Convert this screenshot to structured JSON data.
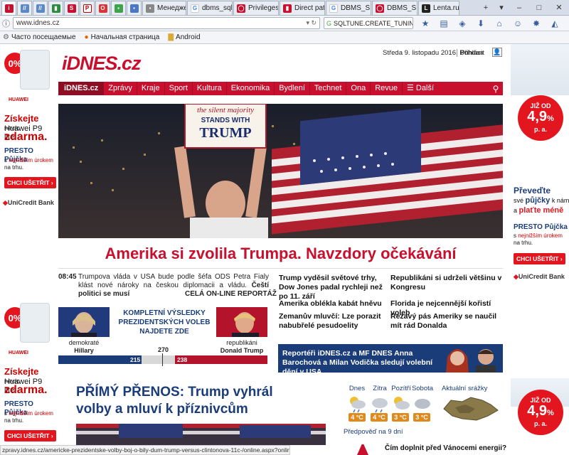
{
  "browser": {
    "tabs": [
      {
        "label": "",
        "icon": "red-i"
      },
      {
        "label": "",
        "icon": "bookmark"
      },
      {
        "label": "",
        "icon": "bookmark"
      },
      {
        "label": "",
        "icon": "flag"
      },
      {
        "label": "",
        "icon": "S"
      },
      {
        "label": "",
        "icon": "P"
      },
      {
        "label": "",
        "icon": "O"
      },
      {
        "label": "",
        "icon": "blue"
      },
      {
        "label": "",
        "icon": "doc"
      },
      {
        "label": "Менедже...",
        "icon": "doc"
      },
      {
        "label": "dbms_sql...",
        "icon": "G"
      },
      {
        "label": "Privileges...",
        "icon": "oracle"
      },
      {
        "label": "Direct pat...",
        "icon": "bookmark"
      },
      {
        "label": "DBMS_S...",
        "icon": "G"
      },
      {
        "label": "DBMS_S...",
        "icon": "oracle"
      },
      {
        "label": "Lenta.ru",
        "icon": "L"
      }
    ],
    "url": "www.idnes.cz",
    "search_text": "SQLTUNE.CREATE_TUNING_TASK",
    "bookmarks": [
      "Часто посещаемые",
      "Начальная страница",
      "Android"
    ],
    "status_url": "zpravy.idnes.cz/americke-prezidentske-volby-boj-o-bily-dum-trump-versus-clintonova-11c-/online.aspx?online=1006336"
  },
  "ad_left": {
    "promo_label": "0%",
    "brand": "HUAWEI",
    "line1": "Získejte",
    "line1b": "navíc",
    "line2": "Huawei P9 lite",
    "line3": "zdarma.",
    "line4": "PRESTO Půjčka",
    "line5a": "s",
    "line5b": "nejnižším úrokem",
    "line6": "na trhu.",
    "button": "CHCI UŠETŘIT ›",
    "bank": "UniCredit Bank"
  },
  "ad_right": {
    "badge_top": "JIŽ OD",
    "badge_value": "4,9",
    "badge_unit": "%",
    "badge_sub": "p. a.",
    "line1": "Převeďte",
    "line2a": "své",
    "line2b": "půjčky",
    "line2c": "k nám",
    "line3a": "a",
    "line3b": "plaťte méně",
    "line4": "PRESTO Půjčka",
    "line5a": "s",
    "line5b": "nejnižším úrokem",
    "line6": "na trhu.",
    "button": "CHCI UŠETŘIT ›",
    "bank": "UniCredit Bank"
  },
  "header": {
    "logo": "iDNES.cz",
    "date": "Středa 9. listopadu 2016. Bohdan",
    "login": "Přihlásit"
  },
  "nav": {
    "brand": "iDNES.cz",
    "items": [
      "Zprávy",
      "Kraje",
      "Sport",
      "Kultura",
      "Ekonomika",
      "Bydlení",
      "Technet",
      "Ona",
      "Revue",
      "☰ Další"
    ]
  },
  "hero": {
    "sign_line1": "the silent majority",
    "sign_line2": "STANDS WITH",
    "sign_line3": "TRUMP",
    "headline": "Amerika si zvolila Trumpa. Navzdory očekávání"
  },
  "live": {
    "time": "08:45",
    "text": "Trumpova vláda v USA bude podle šéfa ODS Petra Fialy klást nové nároky na českou diplomacii a vládu.",
    "text_bold": "Čeští politici se musí",
    "more": "CELÁ ON-LINE REPORTÁŽ"
  },
  "results": {
    "title": "KOMPLETNÍ VÝSLEDKY PREZIDENTSKÝCH VOLEB NAJDETE ZDE",
    "left_party": "demokraté",
    "left_name": "Hillary Clintonová",
    "right_party": "republikáni",
    "right_name": "Donald Trump",
    "threshold": "270",
    "clinton_votes": 215,
    "trump_votes": 238,
    "clinton_label": "215",
    "trump_label": "238"
  },
  "stories_mid": [
    "Trump vyděsil světové trhy, Dow Jones padal rychleji než po 11. září",
    "Amerika oblékla kabát hněvu",
    "Zemanův mluvčí: Lze porazit nabubřelé pesudoelity"
  ],
  "stories_right": [
    "Republikáni si udrželi většinu v Kongresu",
    "Florida je nejcennější kořistí voleb",
    "Rezavý pás Ameriky se naučil mít rád Donalda"
  ],
  "promo": "Reportéři iDNES.cz a MF DNES Anna Barochová a Milan Vodička sledují volební dění v USA",
  "live2": "PŘÍMÝ PŘENOS: Trump vyhrál volby a mluví k příznivcům",
  "weather": {
    "days": [
      "Dnes",
      "Zítra",
      "Pozítří",
      "Sobota"
    ],
    "temps": [
      "4 °C",
      "4 °C",
      "3 °C",
      "3 °C"
    ],
    "current_label": "Aktuální srážky",
    "forecast": "Předpověď na 9 dní"
  },
  "bottom_story": "Čím doplnit před Vánocemi energii?"
}
